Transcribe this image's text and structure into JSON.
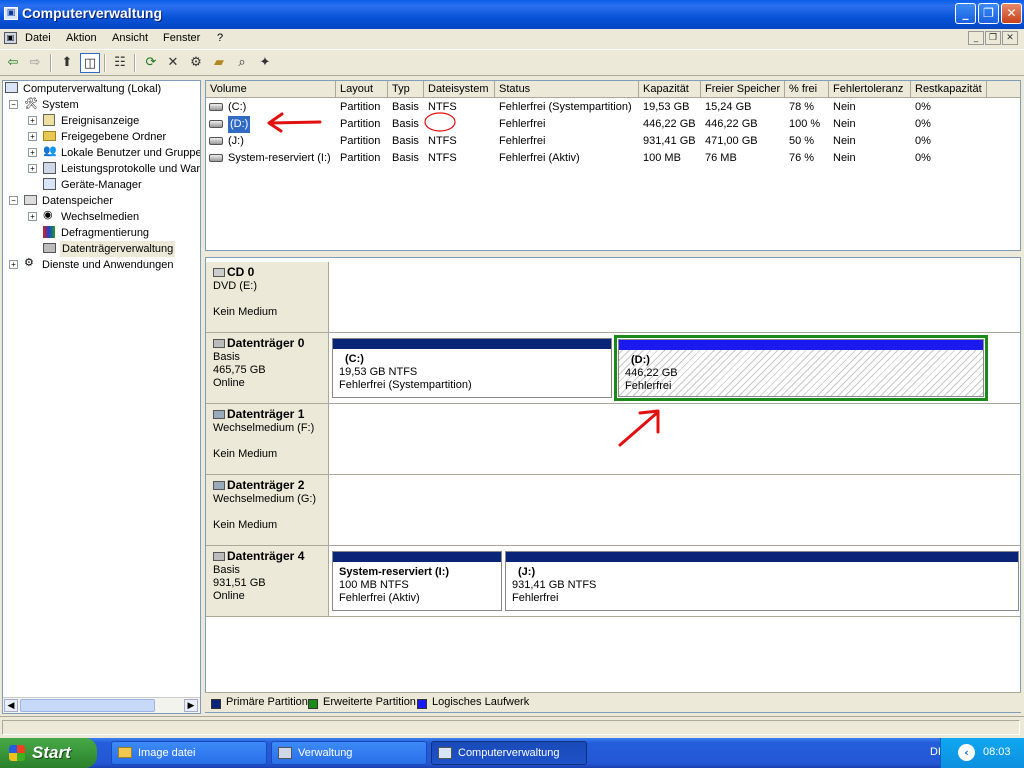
{
  "window": {
    "title": "Computerverwaltung"
  },
  "menu": {
    "items": [
      "Datei",
      "Aktion",
      "Ansicht",
      "Fenster",
      "?"
    ]
  },
  "tree": {
    "items": [
      {
        "label": "Computerverwaltung (Lokal)"
      },
      {
        "label": "System"
      },
      {
        "label": "Ereignisanzeige"
      },
      {
        "label": "Freigegebene Ordner"
      },
      {
        "label": "Lokale Benutzer und Gruppen"
      },
      {
        "label": "Leistungsprotokolle und Warnungen"
      },
      {
        "label": "Geräte-Manager"
      },
      {
        "label": "Datenspeicher"
      },
      {
        "label": "Wechselmedien"
      },
      {
        "label": "Defragmentierung"
      },
      {
        "label": "Datenträgerverwaltung"
      },
      {
        "label": "Dienste und Anwendungen"
      }
    ]
  },
  "volume_list": {
    "columns": [
      "Volume",
      "Layout",
      "Typ",
      "Dateisystem",
      "Status",
      "Kapazität",
      "Freier Speicher",
      "% frei",
      "Fehlertoleranz",
      "Restkapazität"
    ],
    "rows": [
      [
        "(C:)",
        "Partition",
        "Basis",
        "NTFS",
        "Fehlerfrei (Systempartition)",
        "19,53 GB",
        "15,24 GB",
        "78 %",
        "Nein",
        "0%"
      ],
      [
        "(D:)",
        "Partition",
        "Basis",
        "",
        "Fehlerfrei",
        "446,22 GB",
        "446,22 GB",
        "100 %",
        "Nein",
        "0%"
      ],
      [
        "(J:)",
        "Partition",
        "Basis",
        "NTFS",
        "Fehlerfrei",
        "931,41 GB",
        "471,00 GB",
        "50 %",
        "Nein",
        "0%"
      ],
      [
        "System-reserviert (I:)",
        "Partition",
        "Basis",
        "NTFS",
        "Fehlerfrei (Aktiv)",
        "100 MB",
        "76 MB",
        "76 %",
        "Nein",
        "0%"
      ]
    ]
  },
  "disks": [
    {
      "name": "CD 0",
      "line1": "DVD (E:)",
      "line2": "",
      "line3": "Kein Medium"
    },
    {
      "name": "Datenträger 0",
      "line1": "Basis",
      "line2": "465,75 GB",
      "line3": "Online",
      "partitions": [
        {
          "name": "(C:)",
          "size": "19,53 GB NTFS",
          "status": "Fehlerfrei (Systempartition)"
        },
        {
          "name": "(D:)",
          "size": "446,22 GB",
          "status": "Fehlerfrei"
        }
      ]
    },
    {
      "name": "Datenträger 1",
      "line1": "Wechselmedium (F:)",
      "line2": "",
      "line3": "Kein Medium"
    },
    {
      "name": "Datenträger 2",
      "line1": "Wechselmedium (G:)",
      "line2": "",
      "line3": "Kein Medium"
    },
    {
      "name": "Datenträger 4",
      "line1": "Basis",
      "line2": "931,51 GB",
      "line3": "Online",
      "partitions": [
        {
          "name": "System-reserviert  (I:)",
          "size": "100 MB NTFS",
          "status": "Fehlerfrei (Aktiv)"
        },
        {
          "name": "(J:)",
          "size": "931,41 GB NTFS",
          "status": "Fehlerfrei"
        }
      ]
    }
  ],
  "legend": {
    "items": [
      "Primäre Partition",
      "Erweiterte Partition",
      "Logisches Laufwerk"
    ]
  },
  "colors": {
    "primary": "#0a2478",
    "extended": "#1a8a1a",
    "logical": "#1a1af0",
    "annotation": "#e01010"
  },
  "taskbar": {
    "start": "Start",
    "tasks": [
      "Image datei",
      "Verwaltung",
      "Computerverwaltung"
    ],
    "lang": "DE",
    "clock": "08:03"
  }
}
